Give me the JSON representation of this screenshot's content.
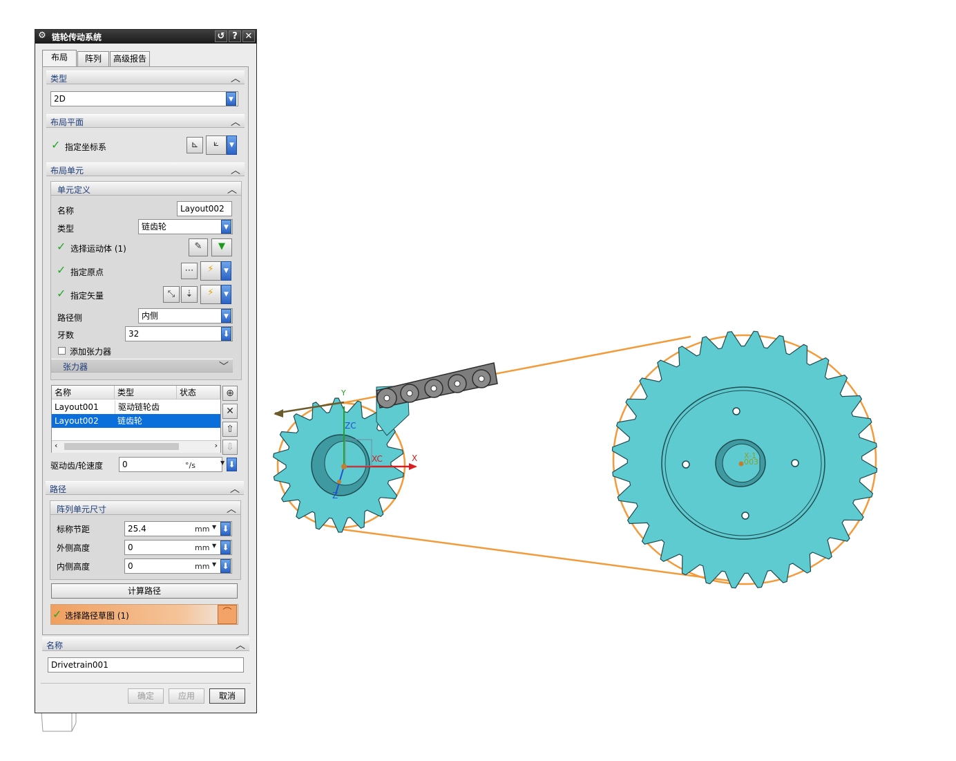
{
  "dialog": {
    "title": "链轮传动系统",
    "title_icon": "gear-icon",
    "tabs": [
      "布局",
      "阵列",
      "高级报告"
    ],
    "active_tab": "布局"
  },
  "type_section": {
    "header": "类型",
    "value": "2D"
  },
  "layout_plane": {
    "header": "布局平面",
    "label": "指定坐标系"
  },
  "layout_unit": {
    "header": "布局单元",
    "unit_def": {
      "header": "单元定义",
      "name_label": "名称",
      "name_value": "Layout002",
      "type_label": "类型",
      "type_value": "链齿轮",
      "select_body_label": "选择运动体 (1)",
      "origin_label": "指定原点",
      "vector_label": "指定矢量",
      "path_side_label": "路径侧",
      "path_side_value": "内侧",
      "teeth_label": "牙数",
      "teeth_value": "32",
      "tensioner_checkbox": "添加张力器",
      "tensioner_header": "张力器"
    },
    "table": {
      "columns": [
        "名称",
        "类型",
        "状态"
      ],
      "rows": [
        {
          "name": "Layout001",
          "type": "驱动链轮齿",
          "status": "",
          "selected": false
        },
        {
          "name": "Layout002",
          "type": "链齿轮",
          "status": "",
          "selected": true
        }
      ]
    },
    "speed_label": "驱动齿/轮速度",
    "speed_value": "0",
    "speed_unit": "°/s"
  },
  "path": {
    "header": "路径",
    "array_size": {
      "header": "阵列单元尺寸",
      "pitch_label": "标称节距",
      "pitch_value": "25.4",
      "outer_label": "外侧高度",
      "outer_value": "0",
      "inner_label": "内侧高度",
      "inner_value": "0",
      "unit": "mm"
    },
    "compute_button": "计算路径",
    "select_sketch_label": "选择路径草图 (1)"
  },
  "name_section": {
    "header": "名称",
    "value": "Drivetrain001"
  },
  "footer": {
    "ok": "确定",
    "apply": "应用",
    "cancel": "取消"
  },
  "viewport": {
    "axis_labels": {
      "zc": "ZC",
      "xc": "XC",
      "x": "X",
      "z": "Z",
      "y": "Y"
    },
    "marker_label": "X-1",
    "marker_sub": "003",
    "colors": {
      "sprocket": "#5ecbd0",
      "chain_path": "#f39a3a",
      "chain": "#7d7d7d"
    }
  }
}
